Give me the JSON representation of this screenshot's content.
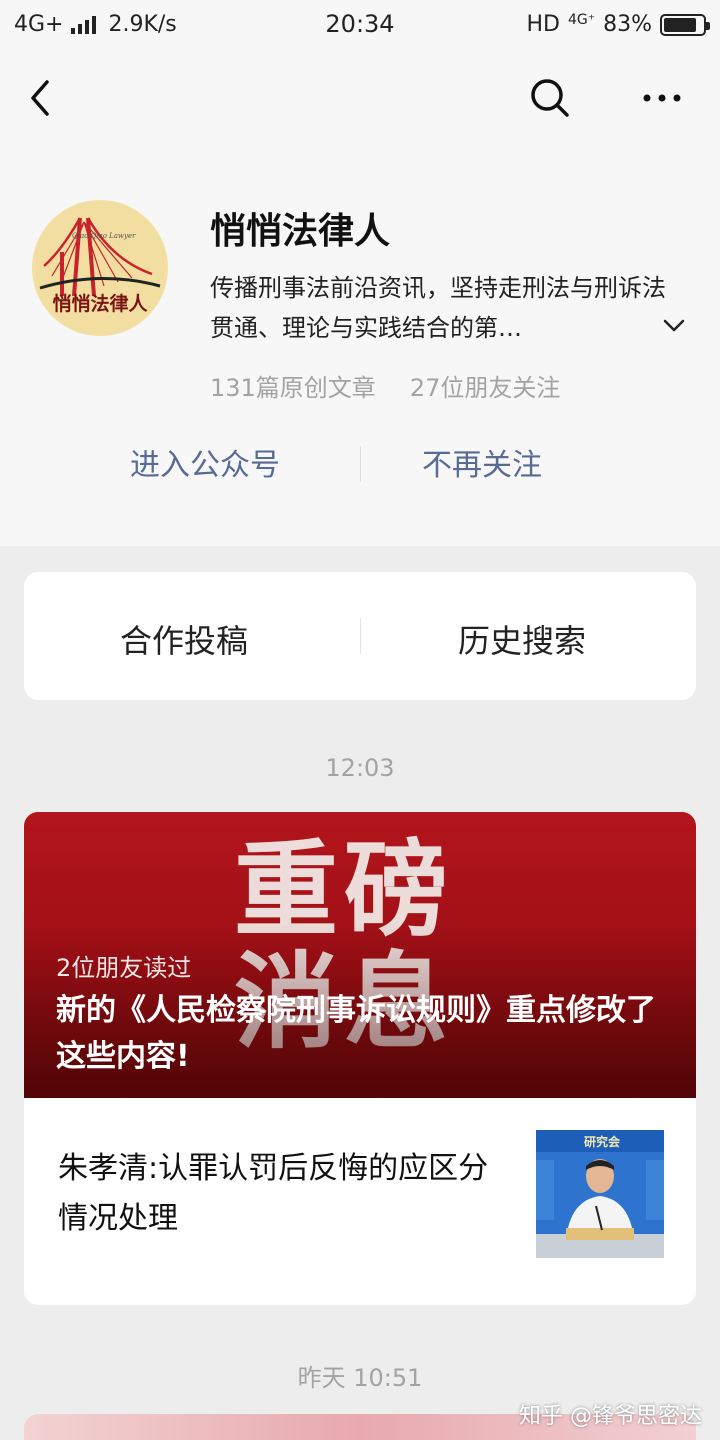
{
  "status_bar": {
    "network": "4G+",
    "speed": "2.9K/s",
    "time": "20:34",
    "hd": "HD",
    "net_badge": "4G⁺",
    "battery_percent": "83%",
    "battery_level": 0.83
  },
  "nav": {
    "back_icon": "chevron-left-icon",
    "search_icon": "search-icon",
    "more_icon": "more-icon"
  },
  "profile": {
    "name": "悄悄法律人",
    "description": "传播刑事法前沿资讯，坚持走刑法与刑诉法贯通、理论与实践结合的第…",
    "original_articles": "131篇原创文章",
    "friends_following": "27位朋友关注",
    "enter_label": "进入公众号",
    "unfollow_label": "不再关注",
    "logo_text": "悄悄法律人",
    "logo_subtext": "Qiao Qiao Lawyer"
  },
  "menu": {
    "item1": "合作投稿",
    "item2": "历史搜索"
  },
  "feed": {
    "time1": "12:03",
    "cover_text": "重磅消息",
    "read_count": "2位朋友读过",
    "headline": "新的《人民检察院刑事诉讼规则》重点修改了这些内容!",
    "sub_title": "朱孝清:认罪认罚后反悔的应区分情况处理",
    "thumb_banner": "研究会",
    "time2": "昨天 10:51"
  },
  "watermark": "知乎 @锋爷思密达",
  "colors": {
    "link_blue": "#576b95",
    "cover_red": "#b3151c",
    "background": "#ededed"
  }
}
